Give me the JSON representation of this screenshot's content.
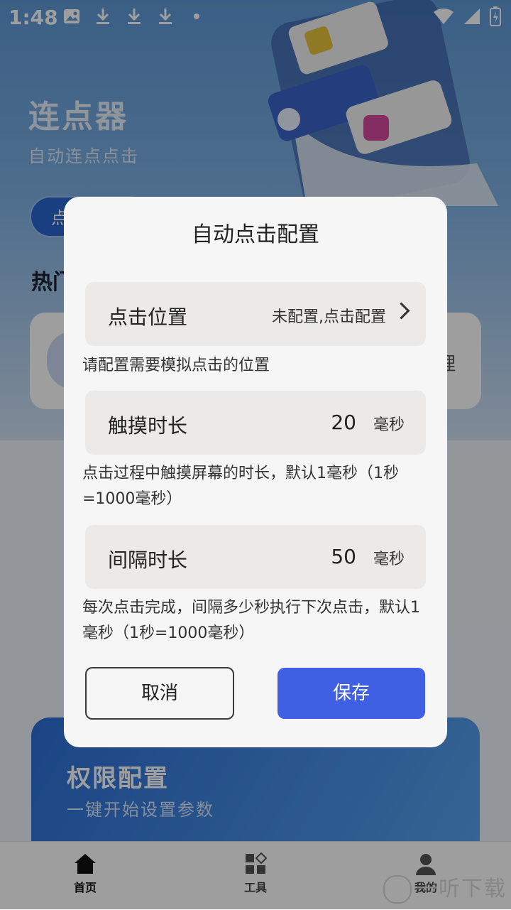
{
  "status_bar": {
    "time": "1:48",
    "notifications": [
      "image-icon",
      "download-icon",
      "download-icon",
      "download-icon",
      "dot-icon"
    ],
    "right_icons": [
      "wifi-icon",
      "signal-icon",
      "battery-charging-icon"
    ]
  },
  "app": {
    "title": "连点器",
    "subtitle": "自动连点点击",
    "chip_label": "点",
    "section_title": "热门",
    "card_trail": "理"
  },
  "permission_card": {
    "title": "权限配置",
    "subtitle": "一键开始设置参数"
  },
  "tab_bar": {
    "tabs": [
      {
        "label": "首页",
        "icon": "home-icon",
        "active": true
      },
      {
        "label": "工具",
        "icon": "tools-icon",
        "active": false
      },
      {
        "label": "我的",
        "icon": "user-icon",
        "active": false
      }
    ]
  },
  "watermark": "一听下载",
  "dialog": {
    "title": "自动点击配置",
    "click_position": {
      "label": "点击位置",
      "value": "未配置,点击配置",
      "hint": "请配置需要模拟点击的位置"
    },
    "touch_duration": {
      "label": "触摸时长",
      "value": "20",
      "unit": "毫秒",
      "hint": "点击过程中触摸屏幕的时长，默认1毫秒（1秒=1000毫秒）"
    },
    "interval_duration": {
      "label": "间隔时长",
      "value": "50",
      "unit": "毫秒",
      "hint": "每次点击完成，间隔多少秒执行下次点击，默认1毫秒（1秒=1000毫秒）"
    },
    "cancel_label": "取消",
    "save_label": "保存"
  },
  "colors": {
    "primary": "#3f60e2",
    "dialog_bg": "#f6f6f6",
    "row_bg": "#ebeae8"
  }
}
